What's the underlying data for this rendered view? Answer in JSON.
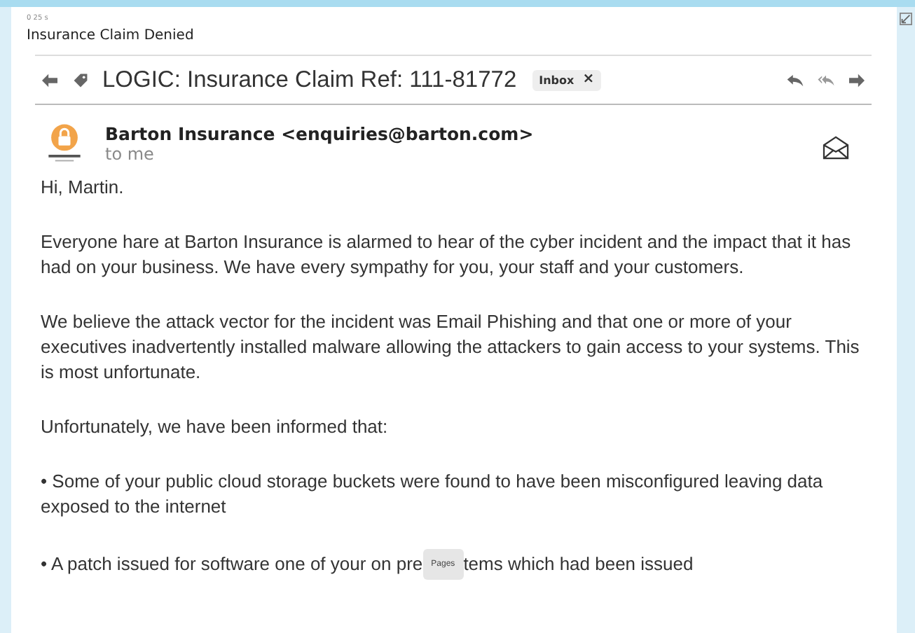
{
  "timer": "0 25 s",
  "window": {
    "title": "Insurance Claim Denied"
  },
  "email": {
    "subject": "LOGIC: Insurance Claim Ref: 111-81772",
    "label": {
      "text": "Inbox",
      "close": "×"
    },
    "sender": "Barton Insurance <enquiries@barton.com>",
    "recipient": "to me",
    "paragraphs": [
      {
        "kind": "text",
        "text": "Hi, Martin."
      },
      {
        "kind": "text",
        "text": "Everyone hare at Barton Insurance is alarmed to hear of the cyber incident and the impact that it has had on your business. We have every sympathy for you, your staff and your customers."
      },
      {
        "kind": "text",
        "text": "We believe the attack vector for the incident was Email Phishing and that one or more of your executives inadvertently installed malware allowing the attackers to gain access to your systems. This is most unfortunate."
      },
      {
        "kind": "text",
        "text": "Unfortunately, we have been informed that:"
      },
      {
        "kind": "text",
        "text": "• Some of your public cloud storage buckets were found to have been misconfigured leaving data exposed to the internet"
      },
      {
        "kind": "covered",
        "before": "• A patch issued for software one of your on pre",
        "tooltip": "Pages",
        "after": "tems which had been issued"
      }
    ]
  }
}
